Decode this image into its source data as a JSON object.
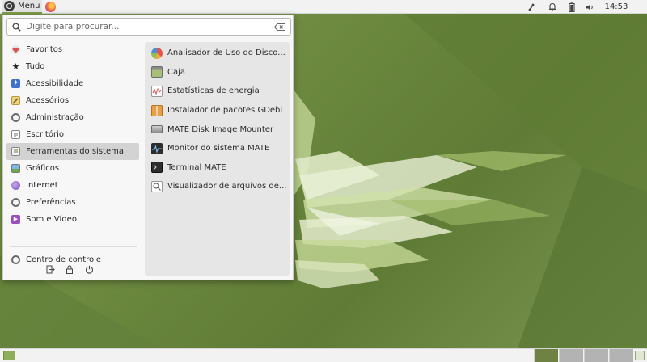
{
  "top_panel": {
    "menu_label": "Menu",
    "clock": "14:53"
  },
  "search": {
    "placeholder": "Digite para procurar..."
  },
  "categories": [
    {
      "label": "Favoritos",
      "icon": "heart-icon"
    },
    {
      "label": "Tudo",
      "icon": "star-icon"
    },
    {
      "label": "Acessibilidade",
      "icon": "accessibility-icon"
    },
    {
      "label": "Acessórios",
      "icon": "accessories-icon"
    },
    {
      "label": "Administração",
      "icon": "administration-icon"
    },
    {
      "label": "Escritório",
      "icon": "office-icon"
    },
    {
      "label": "Ferramentas do sistema",
      "icon": "system-tools-icon",
      "selected": true
    },
    {
      "label": "Gráficos",
      "icon": "graphics-icon"
    },
    {
      "label": "Internet",
      "icon": "internet-icon"
    },
    {
      "label": "Preferências",
      "icon": "preferences-icon"
    },
    {
      "label": "Som e Vídeo",
      "icon": "sound-video-icon"
    }
  ],
  "control_center": {
    "label": "Centro de controle",
    "icon": "control-center-icon"
  },
  "apps": [
    {
      "label": "Analisador de Uso do Disco...",
      "icon": "disk-usage-icon"
    },
    {
      "label": "Caja",
      "icon": "file-manager-icon"
    },
    {
      "label": "Estatísticas de energia",
      "icon": "power-statistics-icon"
    },
    {
      "label": "Instalador de pacotes GDebi",
      "icon": "package-installer-icon"
    },
    {
      "label": "MATE Disk Image Mounter",
      "icon": "disk-image-icon"
    },
    {
      "label": "Monitor do sistema MATE",
      "icon": "system-monitor-icon"
    },
    {
      "label": "Terminal MATE",
      "icon": "terminal-icon"
    },
    {
      "label": "Visualizador de arquivos de...",
      "icon": "log-viewer-icon"
    }
  ],
  "colors": {
    "accent": "#7fa24a",
    "panel": "#f2f2f2",
    "selected_row": "#d3d3d3",
    "active_workspace": "#6f8244"
  }
}
